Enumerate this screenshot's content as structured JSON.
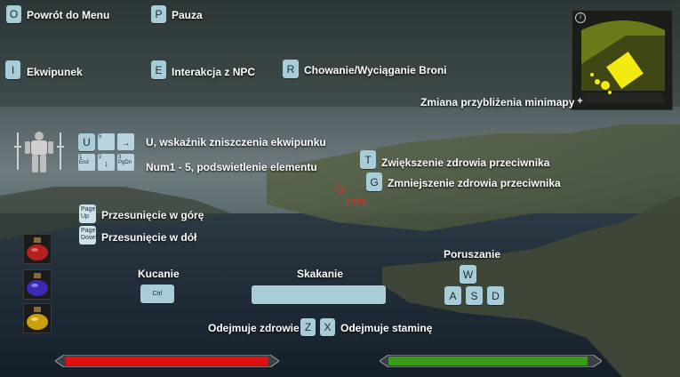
{
  "controls": {
    "menu": {
      "key": "O",
      "label": "Powrót do Menu"
    },
    "pause": {
      "key": "P",
      "label": "Pauza"
    },
    "inventory": {
      "key": "I",
      "label": "Ekwipunek"
    },
    "npc": {
      "key": "E",
      "label": "Interakcja z NPC"
    },
    "weapon": {
      "key": "R",
      "label": "Chowanie/Wyciąganie Broni"
    },
    "minimap_zoom": {
      "key": "+",
      "label": "Zmiana przybliżenia minimapy"
    },
    "equip_damage": {
      "key": "U",
      "label": "U, wskaźnik zniszczenia ekwipunku"
    },
    "highlight": {
      "label": "Num1 - 5, podswietlenie elementu"
    },
    "enemy_hp_up": {
      "key": "T",
      "label": "Zwiększenie zdrowia przeciwnika"
    },
    "enemy_hp_down": {
      "key": "G",
      "label": "Zmniejszenie zdrowia przeciwnika"
    },
    "page_up": {
      "key_line1": "Page",
      "key_line2": "Up",
      "label": "Przesunięcie w górę"
    },
    "page_down": {
      "key_line1": "Page",
      "key_line2": "Down",
      "label": "Przesunięcie w dół"
    },
    "crouch": {
      "key": "Ctrl",
      "label": "Kucanie"
    },
    "jump": {
      "label": "Skakanie"
    },
    "movement": {
      "label": "Poruszanie",
      "keys": [
        "W",
        "A",
        "S",
        "D"
      ]
    },
    "hp_minus": {
      "key": "Z",
      "label": "Odejmuje zdrowie"
    },
    "stamina_minus": {
      "key": "X",
      "label": "Odejmuje staminę"
    }
  },
  "numpad": {
    "keys": [
      {
        "top": "",
        "main": "",
        "arrow": ""
      },
      {
        "top": "5",
        "main": "",
        "arrow": ""
      },
      {
        "top": "",
        "main": "",
        "arrow": "→"
      },
      {
        "top": "1",
        "main": "End",
        "arrow": ""
      },
      {
        "top": "2",
        "main": "",
        "arrow": "↓"
      },
      {
        "top": "3",
        "main": "PgDn",
        "arrow": ""
      }
    ]
  },
  "target_health": "100%",
  "minimap_info_icon": "i",
  "colors": {
    "health": "#e01010",
    "stamina": "#3a9a1a",
    "key": "#a9ccd9",
    "target": "#c0392b"
  },
  "icons": {
    "potion_red": "potion-red-icon",
    "potion_blue": "potion-blue-icon",
    "potion_yellow": "potion-yellow-icon"
  },
  "bars": {
    "health_fraction": 1.0,
    "stamina_fraction": 1.0
  }
}
